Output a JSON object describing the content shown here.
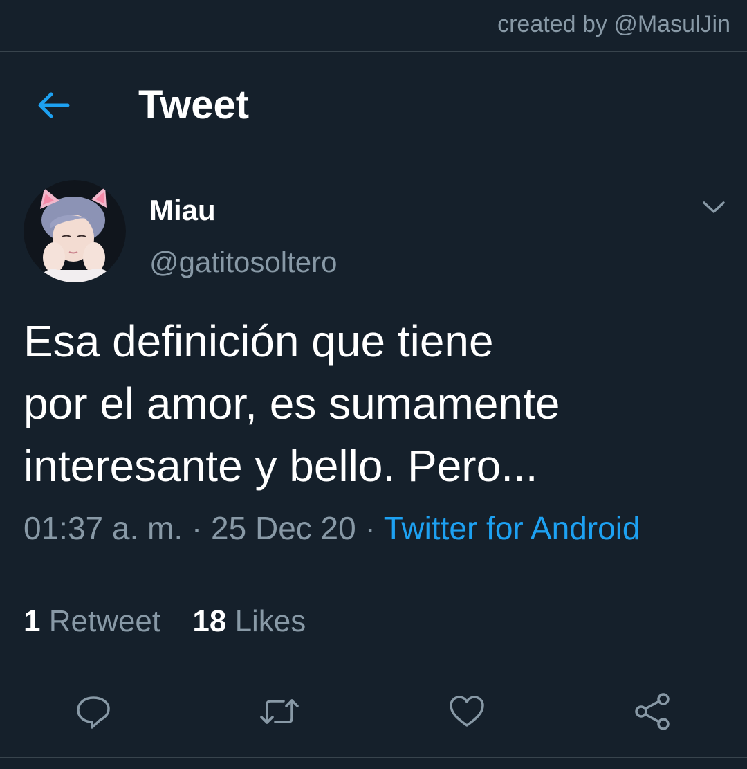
{
  "credit": "created by @MasulJin",
  "header": {
    "title": "Tweet",
    "back_icon": "arrow-left-icon"
  },
  "colors": {
    "background": "#15202b",
    "accent": "#1da1f2",
    "muted": "#8899a6",
    "divider": "#38444d"
  },
  "tweet": {
    "display_name": "Miau",
    "handle": "@gatitosoltero",
    "text": "Esa definición que tiene\npor el amor, es sumamente\ninteresante y bello. Pero...",
    "time": "01:37 a. m.",
    "separator": "·",
    "date": "25 Dec 20",
    "source": "Twitter for Android",
    "retweets": {
      "count": "1",
      "label": "Retweet"
    },
    "likes": {
      "count": "18",
      "label": "Likes"
    }
  },
  "actions": {
    "reply_icon": "reply-icon",
    "retweet_icon": "retweet-icon",
    "like_icon": "heart-icon",
    "share_icon": "share-icon"
  }
}
